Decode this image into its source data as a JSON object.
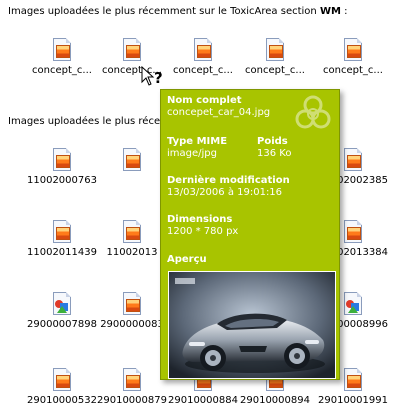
{
  "heading1": {
    "text": "Images uploadées le plus récemment sur le ToxicArea section ",
    "strong": "WM",
    "suffix": " :"
  },
  "heading2": {
    "text": "Images uploadées le plus récem"
  },
  "row1": [
    {
      "label": "concept_c...",
      "icon": "jpg-file-icon"
    },
    {
      "label": "concept_c...",
      "icon": "jpg-file-icon"
    },
    {
      "label": "concept_c...",
      "icon": "jpg-file-icon"
    },
    {
      "label": "concept_c...",
      "icon": "jpg-file-icon"
    },
    {
      "label": "concept_c...",
      "icon": "jpg-file-icon"
    }
  ],
  "row2": [
    {
      "label": "11002000763",
      "icon": "jpg-file-icon"
    },
    {
      "label": "",
      "icon": "jpg-file-icon"
    },
    {
      "label": "",
      "icon": "jpg-file-icon"
    },
    {
      "label": "",
      "icon": "jpg-file-icon"
    },
    {
      "label": "11002002385",
      "icon": "jpg-file-icon"
    }
  ],
  "row3": [
    {
      "label": "11002011439",
      "icon": "jpg-file-icon"
    },
    {
      "label": "11002013",
      "icon": "jpg-file-icon"
    },
    {
      "label": "",
      "icon": "jpg-file-icon"
    },
    {
      "label": "",
      "icon": "jpg-file-icon"
    },
    {
      "label": "11002013384",
      "icon": "jpg-file-icon"
    }
  ],
  "row4": [
    {
      "label": "29000007898",
      "icon": "image-file-icon"
    },
    {
      "label": "2900000083",
      "icon": "jpg-file-icon"
    },
    {
      "label": "",
      "icon": "jpg-file-icon"
    },
    {
      "label": "",
      "icon": "jpg-file-icon"
    },
    {
      "label": "29000008996",
      "icon": "image-file-icon"
    }
  ],
  "row5": [
    {
      "label": "29010000532",
      "icon": "jpg-file-icon"
    },
    {
      "label": "29010000879",
      "icon": "jpg-file-icon"
    },
    {
      "label": "29010000884",
      "icon": "jpg-file-icon"
    },
    {
      "label": "29010000894",
      "icon": "jpg-file-icon"
    },
    {
      "label": "29010001991",
      "icon": "jpg-file-icon"
    }
  ],
  "tooltip": {
    "name_title": "Nom complet",
    "name_value": "concepet_car_04.jpg",
    "mime_title": "Type MIME",
    "mime_value": "image/jpg",
    "size_title": "Poids",
    "size_value": "136 Ko",
    "modified_title": "Dernière modification",
    "modified_value": "13/03/2006 à 19:01:16",
    "dims_title": "Dimensions",
    "dims_value": "1200 * 780 px",
    "preview_title": "Aperçu",
    "bg_color": "#a8c400"
  }
}
